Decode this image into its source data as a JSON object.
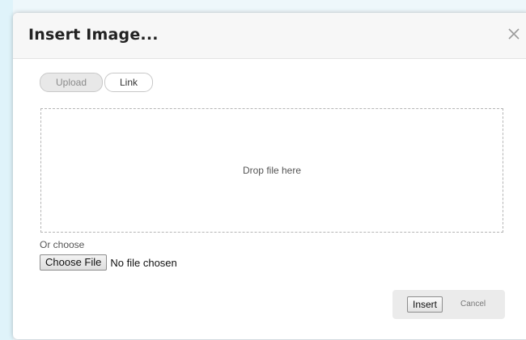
{
  "dialog": {
    "title": "Insert Image...",
    "close_icon": "close-icon"
  },
  "tabs": [
    {
      "label": "Upload",
      "active": true
    },
    {
      "label": "Link",
      "active": false
    }
  ],
  "drop_zone": {
    "label": "Drop file here"
  },
  "file_picker": {
    "prompt": "Or choose",
    "button_label": "Choose File",
    "status": "No file chosen"
  },
  "footer": {
    "insert_label": "Insert",
    "cancel_label": "Cancel"
  },
  "colors": {
    "header_background": "#f7f7f7",
    "active_tab_background": "#e8e8e8",
    "drop_zone_border": "#b5b5b5",
    "footer_background": "#ebebeb"
  }
}
